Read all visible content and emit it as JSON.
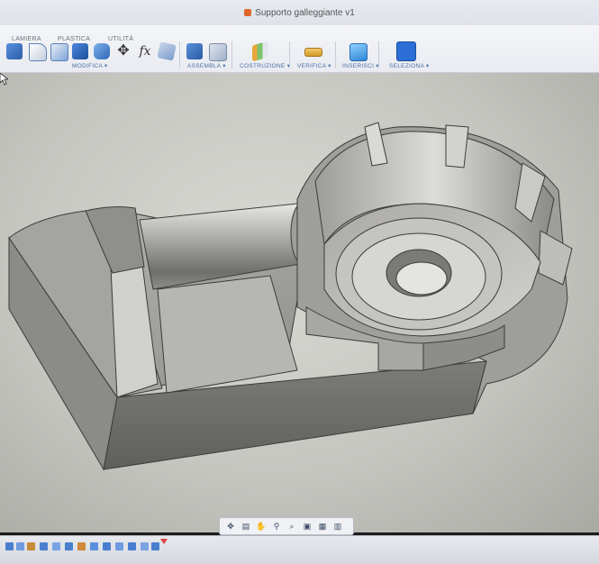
{
  "window": {
    "title": "Supporto galleggiante v1"
  },
  "ribbon": {
    "tabs": [
      "LAMIERA",
      "PLASTICA",
      "UTILITÀ"
    ],
    "groups": [
      "MODIFICA ▾",
      "ASSEMBLA ▾",
      "COSTRUZIONE ▾",
      "VERIFICA ▾",
      "INSERISCI ▾",
      "SELEZIONA ▾"
    ]
  },
  "tool_icons": [
    "press-pull-icon",
    "fillet-icon",
    "chamfer-icon",
    "shell-icon",
    "combine-icon",
    "move-icon",
    "parameters-icon",
    "split-icon",
    "new-component-icon",
    "joint-icon",
    "construction-plane-icon",
    "measure-icon",
    "insert-image-icon",
    "select-icon"
  ],
  "navbar": {
    "icons": [
      "orbit-icon",
      "look-at-icon",
      "pan-icon",
      "zoom-icon",
      "fit-icon",
      "display-style-icon",
      "grid-icon",
      "viewports-icon"
    ]
  },
  "colors": {
    "accent": "#2b6fd6",
    "model": "#9a9a96",
    "background": "#c9c9c4"
  }
}
